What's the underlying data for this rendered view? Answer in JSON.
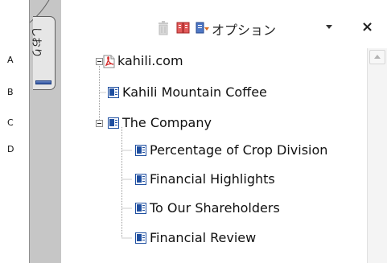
{
  "sidebar": {
    "tab_label": "しおり",
    "tab_icon": "bookmark-tab-icon"
  },
  "toolbar": {
    "trash_icon": "trash-icon",
    "bookmark_icon": "expand-bookmark-icon",
    "bookmark2_icon": "new-bookmark-icon",
    "options_label": "オプション",
    "options_arrow": "chevron-down-icon",
    "close_label": "×"
  },
  "tree": {
    "items": [
      {
        "label": "kahili.com",
        "icon": "pdf-document-icon",
        "expanded": true
      },
      {
        "label": "Kahili Mountain Coffee",
        "icon": "bookmark-icon"
      },
      {
        "label": "The Company",
        "icon": "bookmark-icon",
        "expanded": true
      },
      {
        "label": "Percentage of Crop Division",
        "icon": "bookmark-icon"
      },
      {
        "label": "Financial Highlights",
        "icon": "bookmark-icon"
      },
      {
        "label": "To Our Shareholders",
        "icon": "bookmark-icon"
      },
      {
        "label": "Financial Review",
        "icon": "bookmark-icon"
      }
    ]
  },
  "callouts": {
    "a": "A",
    "b": "B",
    "c": "C",
    "d": "D"
  },
  "colors": {
    "sidebar_bg": "#c6c6c6",
    "tab_bg": "#e6e6e6",
    "bookmark_blue": "#1f4fa0",
    "pdf_red": "#d32a2a"
  }
}
